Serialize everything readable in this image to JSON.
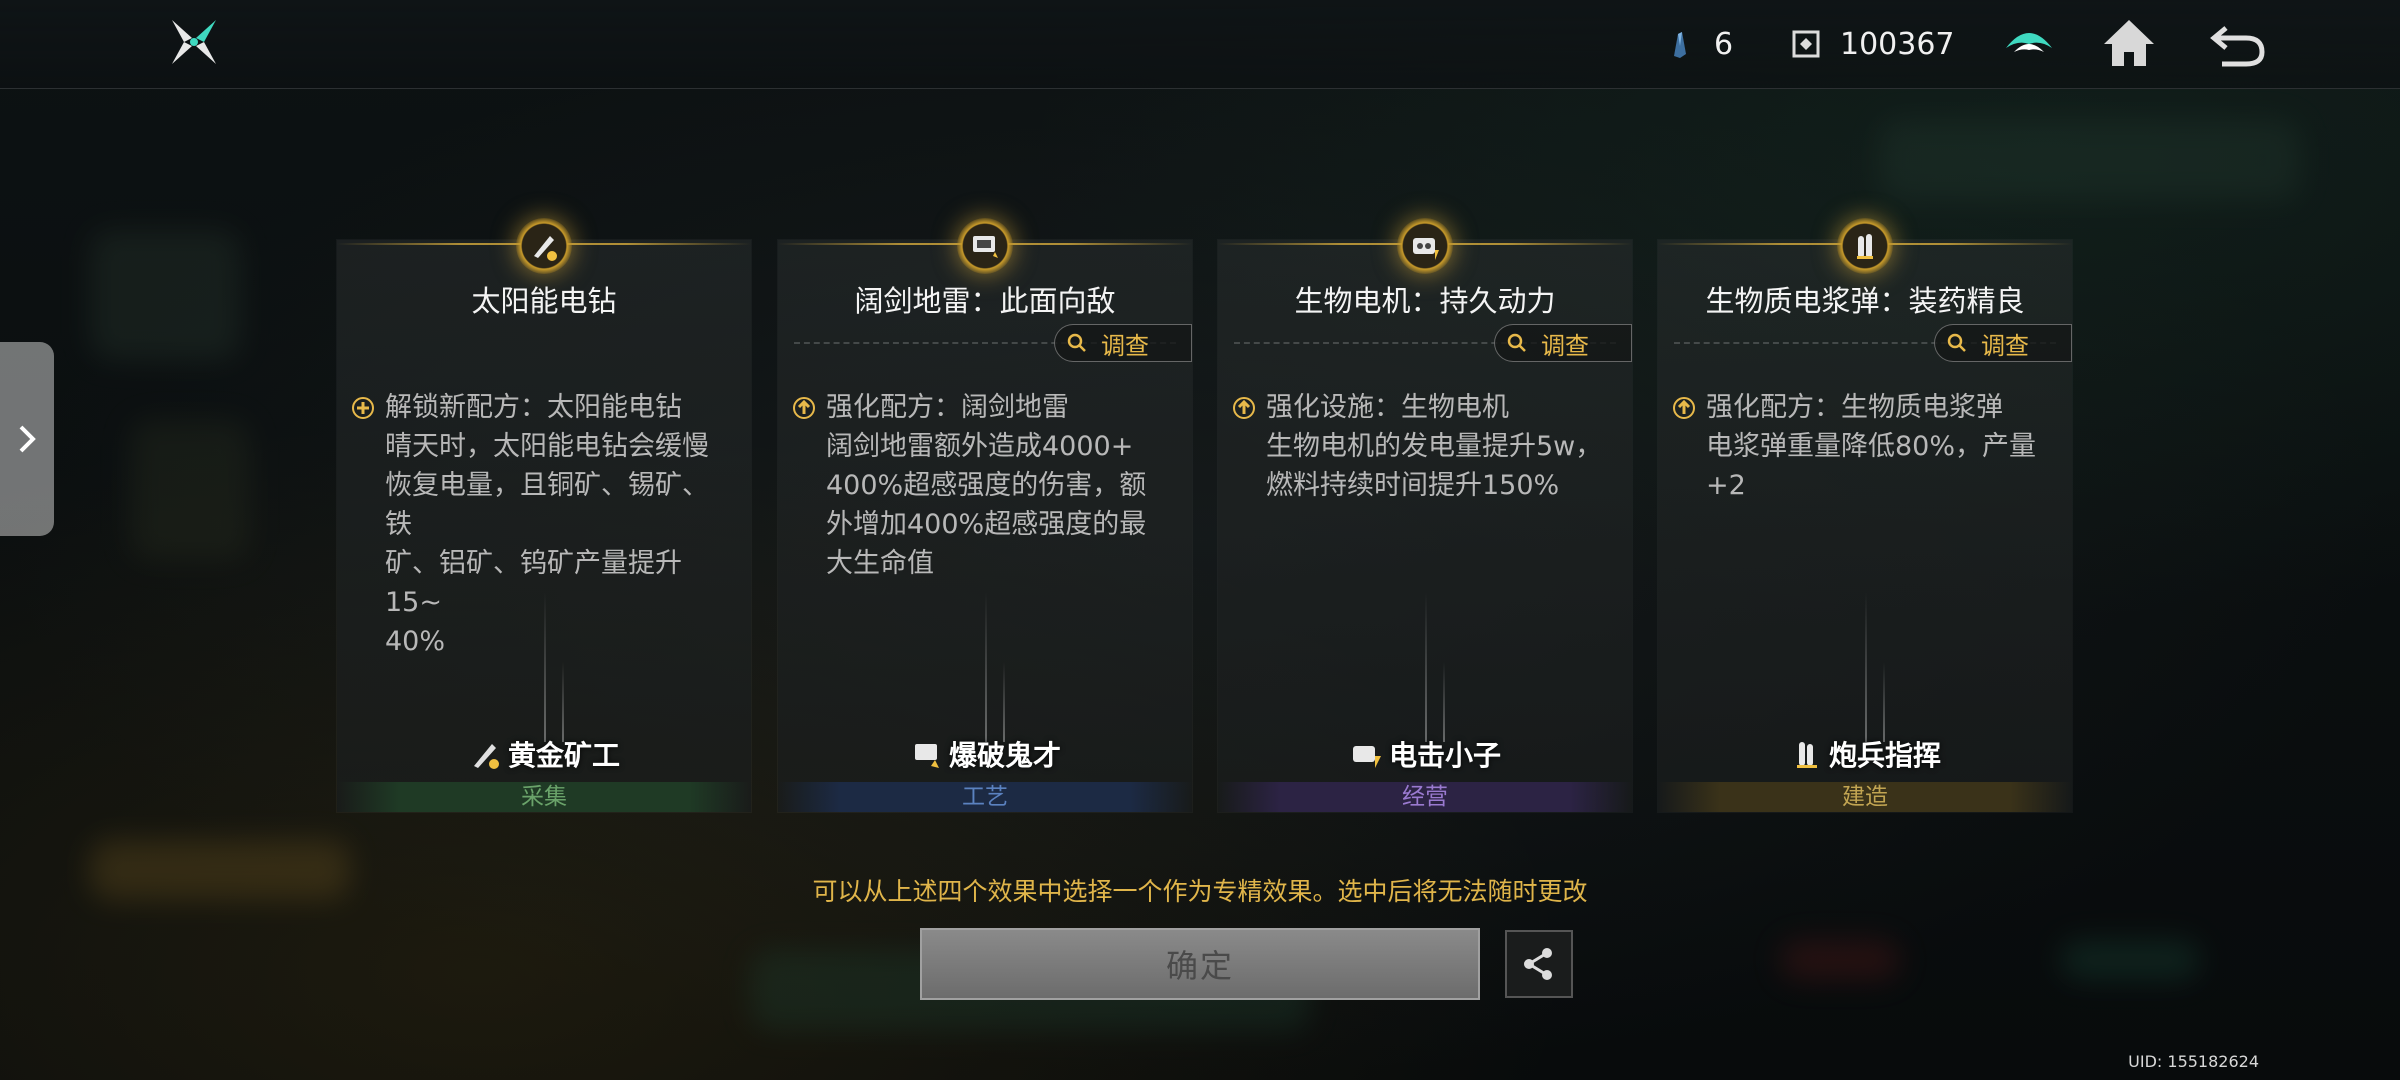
{
  "topbar": {
    "resource_1_value": "6",
    "resource_2_value": "100367",
    "icons": [
      "logo-icon",
      "crystal-icon",
      "gear-chip-icon",
      "leaderboard-icon",
      "home-icon",
      "back-icon"
    ]
  },
  "cards": [
    {
      "title": "太阳能电钻",
      "has_probe": false,
      "effect_type": "unlock",
      "effect": "解锁新配方：太阳能电钻\n晴天时，太阳能电钻会缓慢\n恢复电量，且铜矿、锡矿、铁\n矿、铝矿、钨矿产量提升15~\n40%",
      "hero_name": "黄金矿工",
      "category": "采集",
      "category_color": "#6aa36a",
      "category_bg": "#1f3a25"
    },
    {
      "title": "阔剑地雷：此面向敌",
      "has_probe": true,
      "probe_label": "调查",
      "effect_type": "enhance",
      "effect": "强化配方：阔剑地雷\n阔剑地雷额外造成4000+\n400%超感强度的伤害，额\n外增加400%超感强度的最\n大生命值",
      "hero_name": "爆破鬼才",
      "category": "工艺",
      "category_color": "#5b82c0",
      "category_bg": "#1c2a44"
    },
    {
      "title": "生物电机：持久动力",
      "has_probe": true,
      "probe_label": "调查",
      "effect_type": "enhance",
      "effect": "强化设施：生物电机\n生物电机的发电量提升5w，\n燃料持续时间提升150%",
      "hero_name": "电击小子",
      "category": "经营",
      "category_color": "#9a7ad0",
      "category_bg": "#2c2344"
    },
    {
      "title": "生物质电浆弹：装药精良",
      "has_probe": true,
      "probe_label": "调查",
      "effect_type": "enhance",
      "effect": "强化配方：生物质电浆弹\n电浆弹重量降低80%，产量\n+2",
      "hero_name": "炮兵指挥",
      "category": "建造",
      "category_color": "#c2a552",
      "category_bg": "#3a3219"
    }
  ],
  "notice": "可以从上述四个效果中选择一个作为专精效果。选中后将无法随时更改",
  "confirm_label": "确定",
  "uid": "UID: 155182624",
  "colors": {
    "accent_gold": "#e8b94a",
    "confirm_disabled": "#7a7a7a"
  }
}
